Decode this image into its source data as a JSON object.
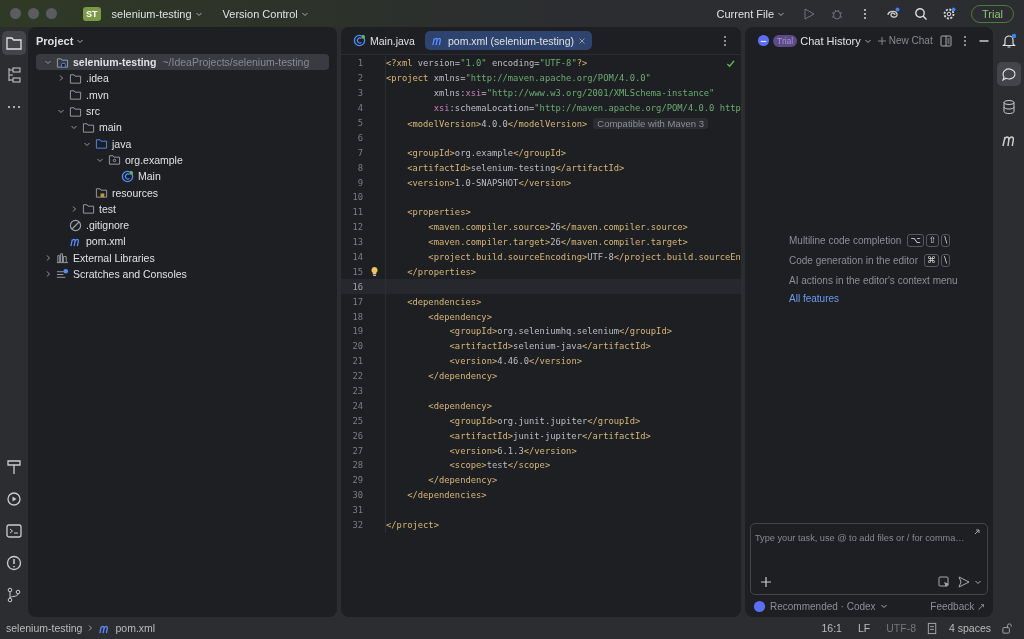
{
  "titlebar": {
    "project_badge": "ST",
    "project": "selenium-testing",
    "vcs": "Version Control",
    "run_config": "Current File",
    "trial": "Trial"
  },
  "project": {
    "title": "Project",
    "tree": [
      {
        "label": "selenium-testing",
        "path": "~/IdeaProjects/selenium-testing",
        "kind": "project",
        "expanded": true,
        "selected": true,
        "children": [
          {
            "label": ".idea",
            "kind": "folder",
            "expanded": false,
            "selected": false
          },
          {
            "label": ".mvn",
            "kind": "folder",
            "selected": false
          },
          {
            "label": "src",
            "kind": "folder",
            "expanded": true,
            "selected": false,
            "children": [
              {
                "label": "main",
                "kind": "folder",
                "expanded": true,
                "selected": false,
                "children": [
                  {
                    "label": "java",
                    "kind": "source",
                    "expanded": true,
                    "selected": false,
                    "children": [
                      {
                        "label": "org.example",
                        "kind": "package",
                        "expanded": true,
                        "selected": false,
                        "children": [
                          {
                            "label": "Main",
                            "kind": "class",
                            "selected": false
                          }
                        ]
                      }
                    ]
                  },
                  {
                    "label": "resources",
                    "kind": "resources",
                    "selected": false
                  }
                ]
              },
              {
                "label": "test",
                "kind": "folder",
                "expanded": false,
                "selected": false
              }
            ]
          },
          {
            "label": ".gitignore",
            "kind": "ignore",
            "selected": false
          },
          {
            "label": "pom.xml",
            "kind": "maven",
            "selected": false
          }
        ]
      },
      {
        "label": "External Libraries",
        "kind": "library",
        "expanded": false,
        "selected": false
      },
      {
        "label": "Scratches and Consoles",
        "kind": "scratches",
        "expanded": false,
        "selected": false
      }
    ]
  },
  "editor": {
    "tabs": [
      {
        "label": "Main.java",
        "kind": "class",
        "selected": false
      },
      {
        "label": "pom.xml (selenium-testing)",
        "kind": "maven",
        "selected": true
      }
    ],
    "lines": [
      {
        "no": "1",
        "current": false,
        "segments": [
          {
            "kind": "tag",
            "text": "<?xml"
          },
          {
            "kind": "attr",
            "text": " version="
          },
          {
            "kind": "val",
            "text": "\"1.0\""
          },
          {
            "kind": "attr",
            "text": " encoding="
          },
          {
            "kind": "val",
            "text": "\"UTF-8\""
          },
          {
            "kind": "tag",
            "text": "?>"
          }
        ]
      },
      {
        "no": "2",
        "current": false,
        "segments": [
          {
            "kind": "tag",
            "text": "<project"
          },
          {
            "kind": "attr",
            "text": " xmlns="
          },
          {
            "kind": "val",
            "text": "\"http://maven.apache.org/POM/4.0.0\""
          }
        ]
      },
      {
        "no": "3",
        "current": false,
        "segments": [
          {
            "kind": "attr",
            "text": "         xmlns:"
          },
          {
            "kind": "ns",
            "text": "xsi"
          },
          {
            "kind": "attr",
            "text": "="
          },
          {
            "kind": "val",
            "text": "\"http://www.w3.org/2001/XMLSchema-instance\""
          }
        ]
      },
      {
        "no": "4",
        "current": false,
        "segments": [
          {
            "kind": "ns",
            "text": "         xsi"
          },
          {
            "kind": "attr",
            "text": ":schemaLocation="
          },
          {
            "kind": "val",
            "text": "\"http://maven.apache.org/POM/4.0.0 http"
          }
        ]
      },
      {
        "no": "5",
        "current": false,
        "segments": [
          {
            "kind": "tag",
            "text": "    <modelVersion>"
          },
          {
            "kind": "txt",
            "text": "4.0.0"
          },
          {
            "kind": "tag",
            "text": "</modelVersion>"
          },
          {
            "kind": "hint",
            "text": "Compatible with Maven 3"
          }
        ]
      },
      {
        "no": "6",
        "current": false
      },
      {
        "no": "7",
        "current": false,
        "segments": [
          {
            "kind": "tag",
            "text": "    <groupId>"
          },
          {
            "kind": "txt",
            "text": "org.example"
          },
          {
            "kind": "tag",
            "text": "</groupId>"
          }
        ]
      },
      {
        "no": "8",
        "current": false,
        "segments": [
          {
            "kind": "tag",
            "text": "    <artifactId>"
          },
          {
            "kind": "txt",
            "text": "selenium-testing"
          },
          {
            "kind": "tag",
            "text": "</artifactId>"
          }
        ]
      },
      {
        "no": "9",
        "current": false,
        "segments": [
          {
            "kind": "tag",
            "text": "    <version>"
          },
          {
            "kind": "txt",
            "text": "1.0-SNAPSHOT"
          },
          {
            "kind": "tag",
            "text": "</version>"
          }
        ]
      },
      {
        "no": "10",
        "current": false
      },
      {
        "no": "11",
        "current": false,
        "segments": [
          {
            "kind": "tag",
            "text": "    <properties>"
          }
        ]
      },
      {
        "no": "12",
        "current": false,
        "segments": [
          {
            "kind": "tag",
            "text": "        <maven.compiler.source>"
          },
          {
            "kind": "txt",
            "text": "26"
          },
          {
            "kind": "tag",
            "text": "</maven.compiler.source>"
          }
        ]
      },
      {
        "no": "13",
        "current": false,
        "segments": [
          {
            "kind": "tag",
            "text": "        <maven.compiler.target>"
          },
          {
            "kind": "txt",
            "text": "26"
          },
          {
            "kind": "tag",
            "text": "</maven.compiler.target>"
          }
        ]
      },
      {
        "no": "14",
        "current": false,
        "segments": [
          {
            "kind": "tag",
            "text": "        <project.build.sourceEncoding>"
          },
          {
            "kind": "txt",
            "text": "UTF-8"
          },
          {
            "kind": "tag",
            "text": "</project.build.sourceEn"
          }
        ]
      },
      {
        "no": "15",
        "current": false,
        "bulb": true,
        "segments": [
          {
            "kind": "tag",
            "text": "    </properties>"
          }
        ]
      },
      {
        "no": "16",
        "current": true
      },
      {
        "no": "17",
        "current": false,
        "segments": [
          {
            "kind": "tag",
            "text": "    <dependencies>"
          }
        ]
      },
      {
        "no": "18",
        "current": false,
        "segments": [
          {
            "kind": "tag",
            "text": "        <dependency>"
          }
        ]
      },
      {
        "no": "19",
        "current": false,
        "segments": [
          {
            "kind": "tag",
            "text": "            <groupId>"
          },
          {
            "kind": "txt",
            "text": "org.seleniumhq.selenium"
          },
          {
            "kind": "tag",
            "text": "</groupId>"
          }
        ]
      },
      {
        "no": "20",
        "current": false,
        "segments": [
          {
            "kind": "tag",
            "text": "            <artifactId>"
          },
          {
            "kind": "txt",
            "text": "selenium-java"
          },
          {
            "kind": "tag",
            "text": "</artifactId>"
          }
        ]
      },
      {
        "no": "21",
        "current": false,
        "segments": [
          {
            "kind": "tag",
            "text": "            <version>"
          },
          {
            "kind": "txt",
            "text": "4.46.0"
          },
          {
            "kind": "tag",
            "text": "</version>"
          }
        ]
      },
      {
        "no": "22",
        "current": false,
        "segments": [
          {
            "kind": "tag",
            "text": "        </dependency>"
          }
        ]
      },
      {
        "no": "23",
        "current": false
      },
      {
        "no": "24",
        "current": false,
        "segments": [
          {
            "kind": "tag",
            "text": "        <dependency>"
          }
        ]
      },
      {
        "no": "25",
        "current": false,
        "segments": [
          {
            "kind": "tag",
            "text": "            <groupId>"
          },
          {
            "kind": "txt",
            "text": "org.junit.jupiter"
          },
          {
            "kind": "tag",
            "text": "</groupId>"
          }
        ]
      },
      {
        "no": "26",
        "current": false,
        "segments": [
          {
            "kind": "tag",
            "text": "            <artifactId>"
          },
          {
            "kind": "txt",
            "text": "junit-jupiter"
          },
          {
            "kind": "tag",
            "text": "</artifactId>"
          }
        ]
      },
      {
        "no": "27",
        "current": false,
        "segments": [
          {
            "kind": "tag",
            "text": "            <version>"
          },
          {
            "kind": "txt",
            "text": "6.1.3"
          },
          {
            "kind": "tag",
            "text": "</version>"
          }
        ]
      },
      {
        "no": "28",
        "current": false,
        "segments": [
          {
            "kind": "tag",
            "text": "            <scope>"
          },
          {
            "kind": "txt",
            "text": "test"
          },
          {
            "kind": "tag",
            "text": "</scope>"
          }
        ]
      },
      {
        "no": "29",
        "current": false,
        "segments": [
          {
            "kind": "tag",
            "text": "        </dependency>"
          }
        ]
      },
      {
        "no": "30",
        "current": false,
        "segments": [
          {
            "kind": "tag",
            "text": "    </dependencies>"
          }
        ]
      },
      {
        "no": "31",
        "current": false
      },
      {
        "no": "32",
        "current": false,
        "segments": [
          {
            "kind": "tag",
            "text": "</project>"
          }
        ]
      }
    ]
  },
  "chat": {
    "badge": "Trial",
    "title": "Chat History",
    "new_chat": "New Chat",
    "tips": [
      {
        "text": "Multiline code completion",
        "keys": [
          "⌥",
          "⇧",
          "\\"
        ]
      },
      {
        "text": "Code generation in the editor",
        "keys": [
          "⌘",
          "\\"
        ]
      },
      {
        "text": "AI actions in the editor's context menu"
      }
    ],
    "link": "All features",
    "input": {
      "placeholder": "Type your task, use @ to add files or / for comma…"
    },
    "model": "Recommended · Codex",
    "feedback": "Feedback ↗"
  },
  "status_bar": {
    "breadcrumbs": [
      "selenium-testing",
      "pom.xml"
    ],
    "position": "16:1",
    "line_separator": "LF",
    "encoding": "UTF-8",
    "indent": "4 spaces"
  }
}
